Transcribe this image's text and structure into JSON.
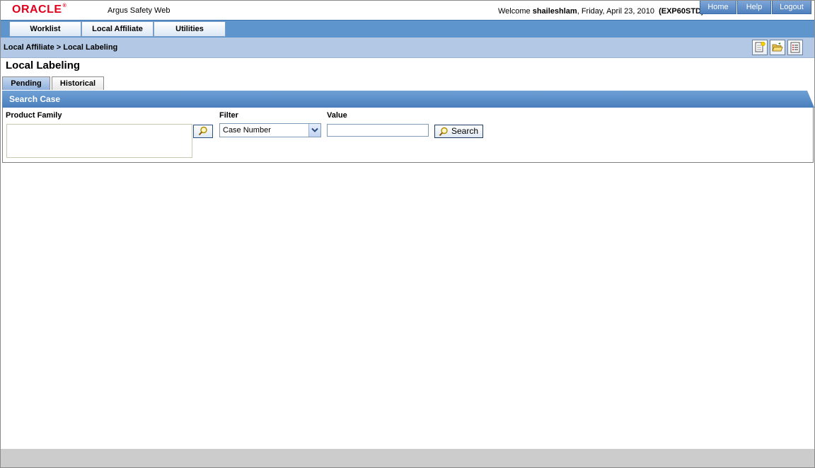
{
  "header": {
    "logo_text": "ORACLE",
    "app_name": "Argus Safety Web",
    "welcome_prefix": "Welcome",
    "user_name": "shaileshlam",
    "date_text": ", Friday, April 23, 2010",
    "env_code": "(EXP60STD)",
    "links": {
      "home": "Home",
      "help": "Help",
      "logout": "Logout"
    }
  },
  "menu": {
    "items": [
      {
        "label": "Worklist"
      },
      {
        "label": "Local Affiliate"
      },
      {
        "label": "Utilities"
      }
    ]
  },
  "breadcrumb": {
    "text": "Local Affiliate > Local Labeling"
  },
  "toolbar_icons": [
    "new-document-icon",
    "open-folder-icon",
    "list-report-icon"
  ],
  "page": {
    "title": "Local Labeling",
    "tabs": [
      {
        "label": "Pending",
        "active": true
      },
      {
        "label": "Historical",
        "active": false
      }
    ]
  },
  "search": {
    "section_title": "Search Case",
    "product_family_label": "Product Family",
    "product_family_value": "",
    "filter_label": "Filter",
    "filter_selected": "Case Number",
    "value_label": "Value",
    "value_text": "",
    "search_button_label": "Search"
  },
  "colors": {
    "menu_bar": "#5f95cd",
    "breadcrumb_bar": "#b3c8e4",
    "section_header": "#5b8fc8",
    "oracle_red": "#e0001b",
    "footer": "#cccccc"
  }
}
